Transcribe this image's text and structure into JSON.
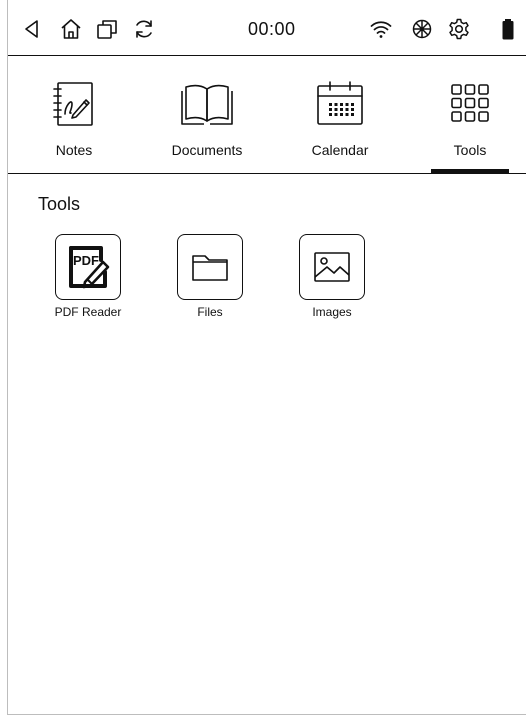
{
  "status_bar": {
    "time": "00:00",
    "icons": [
      "back-icon",
      "home-icon",
      "recent-apps-icon",
      "refresh-icon",
      "wifi-icon",
      "brightness-icon",
      "settings-icon",
      "battery-icon"
    ]
  },
  "tabs": [
    {
      "label": "Notes",
      "icon": "notebook-pen-icon",
      "selected": false
    },
    {
      "label": "Documents",
      "icon": "open-book-icon",
      "selected": false
    },
    {
      "label": "Calendar",
      "icon": "calendar-icon",
      "selected": false
    },
    {
      "label": "Tools",
      "icon": "grid-icon",
      "selected": true
    }
  ],
  "section": {
    "title": "Tools"
  },
  "apps": [
    {
      "label": "PDF Reader",
      "icon": "pdf-reader-icon"
    },
    {
      "label": "Files",
      "icon": "folder-icon"
    },
    {
      "label": "Images",
      "icon": "image-icon"
    }
  ],
  "colors": {
    "ink": "#111111",
    "background": "#ffffff"
  }
}
